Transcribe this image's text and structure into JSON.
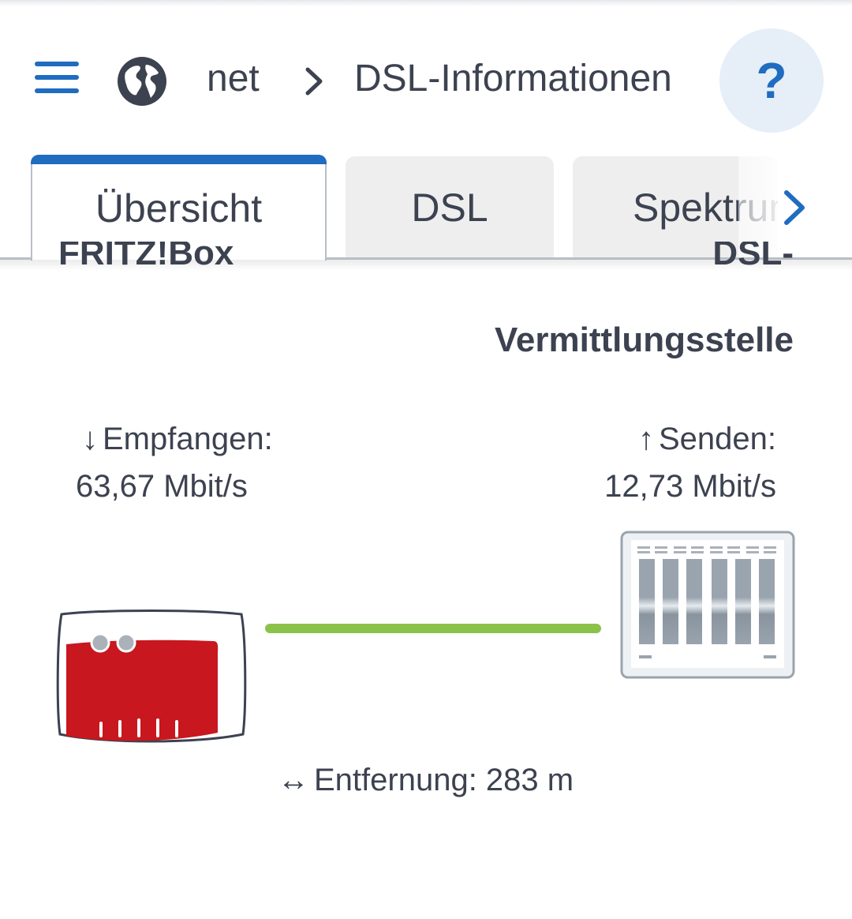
{
  "header": {
    "menu_icon": "hamburger-menu-icon",
    "globe_icon": "globe-icon",
    "breadcrumb_parent": "net",
    "breadcrumb_current": "DSL-Informationen",
    "help_label": "?"
  },
  "tabs": [
    {
      "label": "Übersicht",
      "active": true
    },
    {
      "label": "DSL",
      "active": false
    },
    {
      "label": "Spektrum",
      "active": false
    }
  ],
  "overview": {
    "left_device_label": "FRITZ!Box",
    "right_device_label_line1": "DSL-",
    "right_device_label_line2": "Vermittlungsstelle",
    "receive_label": "Empfangen:",
    "receive_value": "63,67 Mbit/s",
    "send_label": "Senden:",
    "send_value": "12,73 Mbit/s",
    "distance_label": "Entfernung: 283 m"
  },
  "colors": {
    "accent": "#1f6cc0",
    "line_status": "#8bc34a",
    "fritzbox_red": "#c8171e",
    "text": "#3c4250"
  }
}
